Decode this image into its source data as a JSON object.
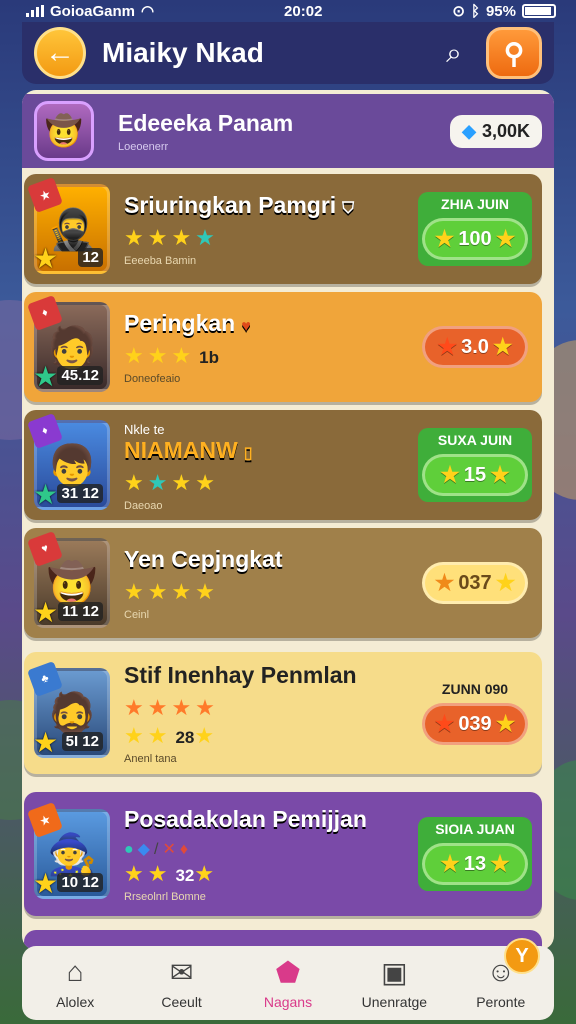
{
  "status": {
    "carrier": "GoioaGanm",
    "time": "20:02",
    "battery": "95%"
  },
  "header": {
    "title": "Miaiky Nkad",
    "back_icon": "arrow-left-icon",
    "search_icon": "search-icon"
  },
  "profile": {
    "name": "Edeeeka Panam",
    "sub": "Loeoenerr",
    "gems": "3,00K"
  },
  "cards": [
    {
      "name": "Sriuringkan Pamgri",
      "level": "12",
      "sub": "Eeeeba Bamin",
      "reward_label": "ZHIA JUIN",
      "reward_value": "100",
      "theme": "brown"
    },
    {
      "name": "Peringkan",
      "level": "45.12",
      "sub": "Doneofeaio",
      "reward_label": "",
      "reward_value": "3.0",
      "theme": "orange"
    },
    {
      "name": "NIAMANW",
      "tag": "Nkle te",
      "level": "31 12",
      "sub": "Daeoao",
      "reward_label": "SUXA JUIN",
      "reward_value": "15",
      "theme": "brown"
    },
    {
      "name": "Yen Cepjngkat",
      "level": "11 12",
      "sub": "Ceinl",
      "reward_label": "",
      "reward_value": "037",
      "theme": "brown2"
    },
    {
      "name": "Stif Inenhay Penmlan",
      "level": "5I 12",
      "sub": "Anenl tana",
      "reward_label": "ZUNN 090",
      "reward_value": "039",
      "theme": "cream",
      "stars_text": "28"
    },
    {
      "name": "Posadakolan Pemijjan",
      "level": "10 12",
      "sub": "Rrseolnrl Bomne",
      "reward_label": "SIOIA JUAN",
      "reward_value": "13",
      "theme": "purple",
      "stars_text": "32"
    }
  ],
  "nav": [
    {
      "label": "Alolex",
      "icon": "home-icon"
    },
    {
      "label": "Ceeult",
      "icon": "chat-icon"
    },
    {
      "label": "Nagans",
      "icon": "house-active-icon"
    },
    {
      "label": "Unenratge",
      "icon": "box-icon"
    },
    {
      "label": "Peronte",
      "icon": "profile-icon",
      "badge": "Y"
    }
  ]
}
